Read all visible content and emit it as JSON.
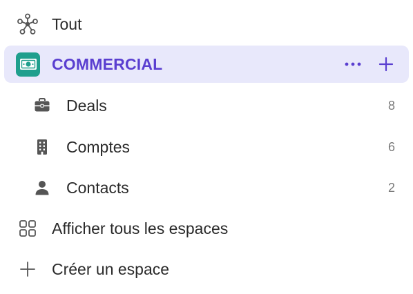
{
  "nav": {
    "all": {
      "label": "Tout",
      "icon": "network-nodes-icon"
    },
    "space": {
      "name": "COMMERCIAL",
      "icon": "money-bill-icon",
      "badge_color": "#1f9f8d",
      "accent_color": "#5a3fd0",
      "more_icon": "more-horizontal-icon",
      "add_icon": "plus-icon"
    },
    "items": [
      {
        "label": "Deals",
        "count": "8",
        "icon": "briefcase-icon"
      },
      {
        "label": "Comptes",
        "count": "6",
        "icon": "building-icon"
      },
      {
        "label": "Contacts",
        "count": "2",
        "icon": "person-icon"
      }
    ],
    "show_all": {
      "label": "Afficher tous les espaces",
      "icon": "grid-icon"
    },
    "create": {
      "label": "Créer un espace",
      "icon": "plus-icon"
    }
  }
}
